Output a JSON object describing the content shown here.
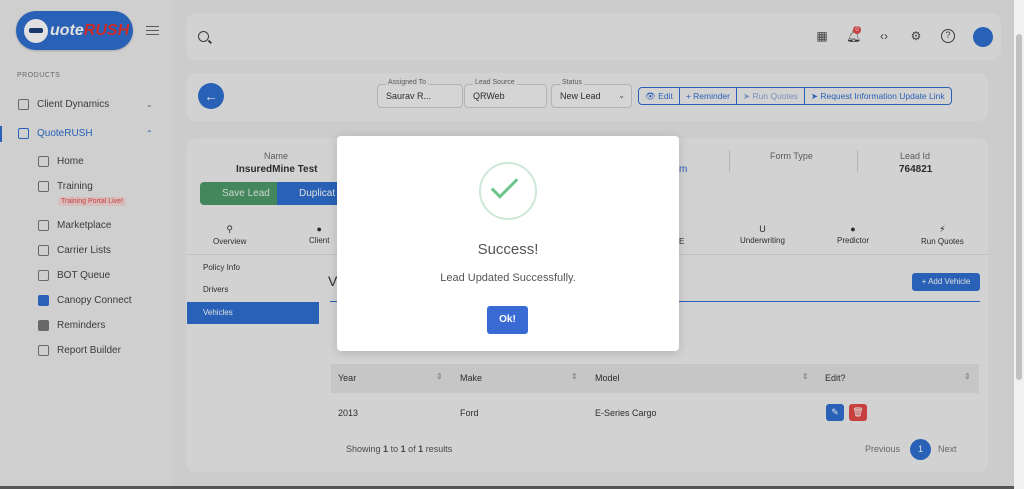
{
  "app": {
    "logo_main": "uote",
    "logo_accent": "RUSH"
  },
  "sidebar": {
    "section_label": "PRODUCTS",
    "client_dynamics": "Client Dynamics",
    "quoterush": "QuoteRUSH",
    "items": [
      {
        "label": "Home",
        "icon": "home-icon"
      },
      {
        "label": "Training",
        "icon": "training-icon",
        "badge": "Training Portal Live!"
      },
      {
        "label": "Marketplace",
        "icon": "store-icon"
      },
      {
        "label": "Carrier Lists",
        "icon": "list-icon"
      },
      {
        "label": "BOT Queue",
        "icon": "robot-icon"
      },
      {
        "label": "Canopy Connect",
        "icon": "canopy-icon"
      },
      {
        "label": "Reminders",
        "icon": "calendar-icon"
      },
      {
        "label": "Report Builder",
        "icon": "report-icon"
      }
    ]
  },
  "topbar": {
    "notification_count": "0"
  },
  "header": {
    "assigned_to_label": "Assigned To",
    "assigned_to_value": "Saurav R...",
    "lead_source_label": "Lead Source",
    "lead_source_value": "QRWeb",
    "status_label": "Status",
    "status_value": "New Lead",
    "actions": {
      "edit": "Edit",
      "reminder": "+ Reminder",
      "run_quotes": "Run Quotes",
      "request_update": "Request Information Update Link"
    }
  },
  "lead": {
    "name_label": "Name",
    "name_value": "InsuredMine Test",
    "partial_link": "m",
    "form_type_label": "Form Type",
    "lead_id_label": "Lead Id",
    "lead_id_value": "764821",
    "save_label": "Save Lead",
    "duplicate_label": "Duplicat"
  },
  "tabs": {
    "overview": "Overview",
    "client": "Client",
    "partial": "E",
    "underwriting": "Underwriting",
    "predictor": "Predictor",
    "run_quotes": "Run Quotes"
  },
  "subnav": {
    "policy_info": "Policy Info",
    "drivers": "Drivers",
    "vehicles": "Vehicles"
  },
  "vehicles": {
    "heading_partial": "V",
    "add_button": "+ Add Vehicle",
    "columns": [
      "Year",
      "Make",
      "Model",
      "Edit?"
    ],
    "rows": [
      {
        "year": "2013",
        "make": "Ford",
        "model": "E-Series Cargo"
      }
    ],
    "showing_prefix": "Showing",
    "showing_from": "1",
    "showing_to_word": "to",
    "showing_to": "1",
    "showing_of_word": "of",
    "showing_total": "1",
    "showing_suffix": "results",
    "previous": "Previous",
    "current_page": "1",
    "next": "Next"
  },
  "modal": {
    "title": "Success!",
    "message": "Lead Updated Successfully.",
    "ok": "Ok!"
  },
  "colors": {
    "accent": "#2f6fd0",
    "success": "#6dc58c",
    "danger": "#e34848",
    "save": "#4e9a6a"
  }
}
